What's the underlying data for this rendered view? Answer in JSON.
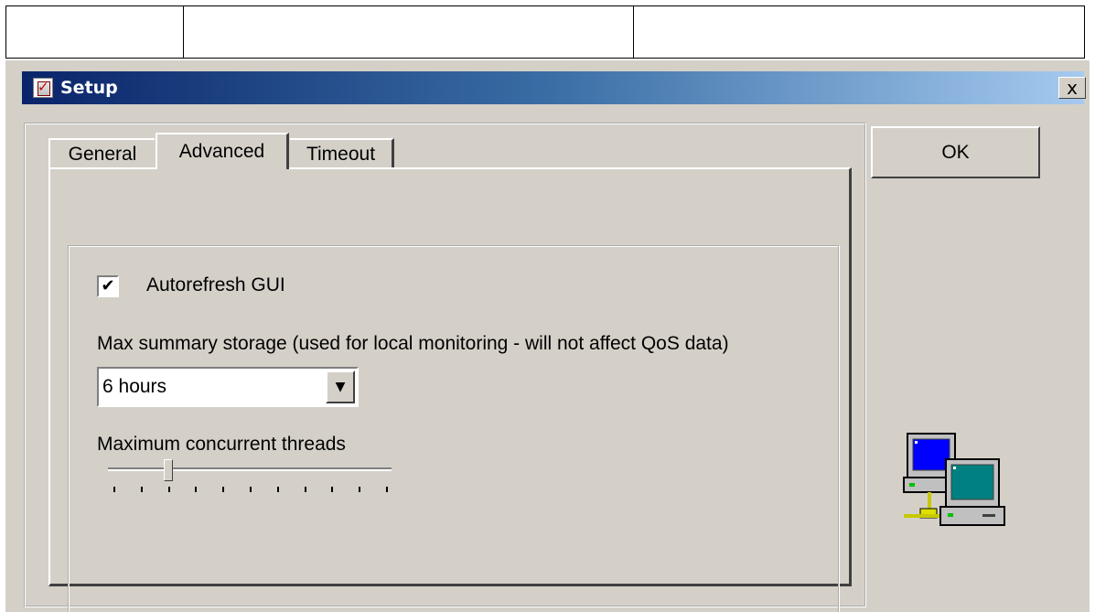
{
  "window": {
    "title": "Setup",
    "close_label": "x"
  },
  "tabs": [
    {
      "label": "General",
      "selected": false
    },
    {
      "label": "Advanced",
      "selected": true
    },
    {
      "label": "Timeout",
      "selected": false
    }
  ],
  "advanced": {
    "autorefresh": {
      "label": "Autorefresh GUI",
      "checked": true
    },
    "max_summary_storage": {
      "label": "Max summary storage (used for local monitoring - will not affect QoS data)",
      "value": "6 hours"
    },
    "max_threads": {
      "label": "Maximum concurrent threads",
      "slider_level": 0.2,
      "tick_count": 11
    }
  },
  "buttons": {
    "ok": "OK"
  },
  "icons": {
    "app": "setup-app-icon",
    "network": "network-computers-icon"
  }
}
